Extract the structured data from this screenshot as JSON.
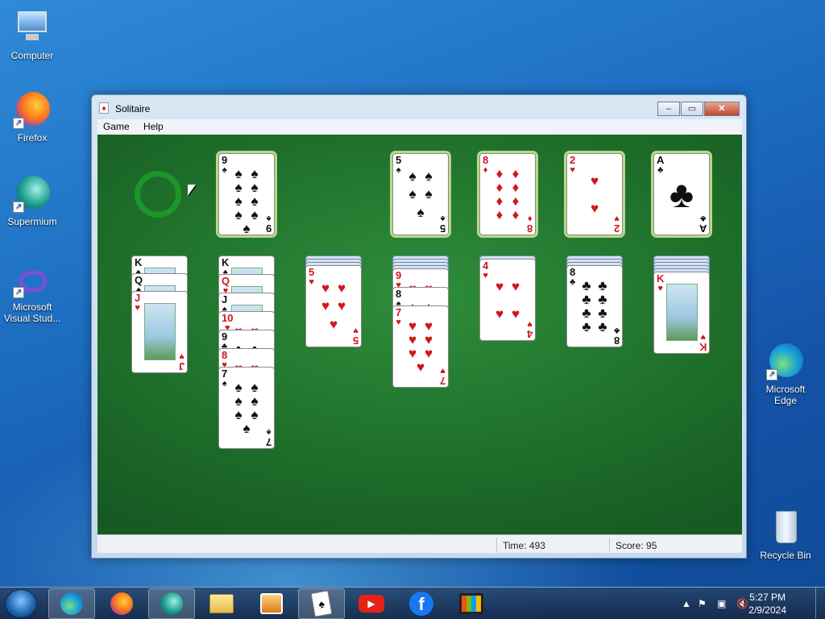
{
  "desktop": {
    "icons": [
      {
        "label": "Computer"
      },
      {
        "label": "Firefox"
      },
      {
        "label": "Supermium"
      },
      {
        "label": "Microsoft Visual Stud..."
      },
      {
        "label": "Microsoft Edge"
      },
      {
        "label": "Recycle Bin"
      }
    ]
  },
  "window": {
    "title": "Solitaire",
    "menu": [
      "Game",
      "Help"
    ],
    "buttons": {
      "minimize": "–",
      "maximize": "▭",
      "close": "✕"
    }
  },
  "game": {
    "stock": "empty",
    "waste": {
      "rank": "9",
      "suit": "♠",
      "color": "black"
    },
    "foundations": [
      {
        "rank": "5",
        "suit": "♠",
        "color": "black"
      },
      {
        "rank": "8",
        "suit": "♦",
        "color": "red"
      },
      {
        "rank": "2",
        "suit": "♥",
        "color": "red"
      },
      {
        "rank": "A",
        "suit": "♣",
        "color": "black"
      }
    ],
    "tableau": [
      {
        "cards": [
          {
            "rank": "K",
            "suit": "♠"
          },
          {
            "rank": "Q",
            "suit": "♠"
          },
          {
            "rank": "J",
            "suit": "♥"
          }
        ]
      },
      {
        "cards": [
          {
            "rank": "K",
            "suit": "♠"
          },
          {
            "rank": "Q",
            "suit": "♥"
          },
          {
            "rank": "J",
            "suit": "♠"
          },
          {
            "rank": "10",
            "suit": "♥"
          },
          {
            "rank": "9",
            "suit": "♣"
          },
          {
            "rank": "8",
            "suit": "♥"
          },
          {
            "rank": "7",
            "suit": "♠"
          }
        ]
      },
      {
        "cards": [
          {
            "rank": "5",
            "suit": "♥"
          }
        ]
      },
      {
        "cards": [
          {
            "rank": "9",
            "suit": "♥"
          },
          {
            "rank": "8",
            "suit": "♠"
          },
          {
            "rank": "7",
            "suit": "♥"
          }
        ]
      },
      {
        "cards": [
          {
            "rank": "4",
            "suit": "♥"
          }
        ]
      },
      {
        "cards": [
          {
            "rank": "8",
            "suit": "♣"
          }
        ]
      },
      {
        "cards": [
          {
            "rank": "K",
            "suit": "♥"
          }
        ]
      }
    ]
  },
  "status": {
    "time_label": "Time:",
    "time_value": "493",
    "score_label": "Score:",
    "score_value": "95"
  },
  "taskbar": {
    "clock_time": "5:27 PM",
    "clock_date": "2/9/2024"
  },
  "colors": {
    "felt": "#1e6e2a",
    "red_suit": "#d0161e",
    "black_suit": "#111111"
  }
}
